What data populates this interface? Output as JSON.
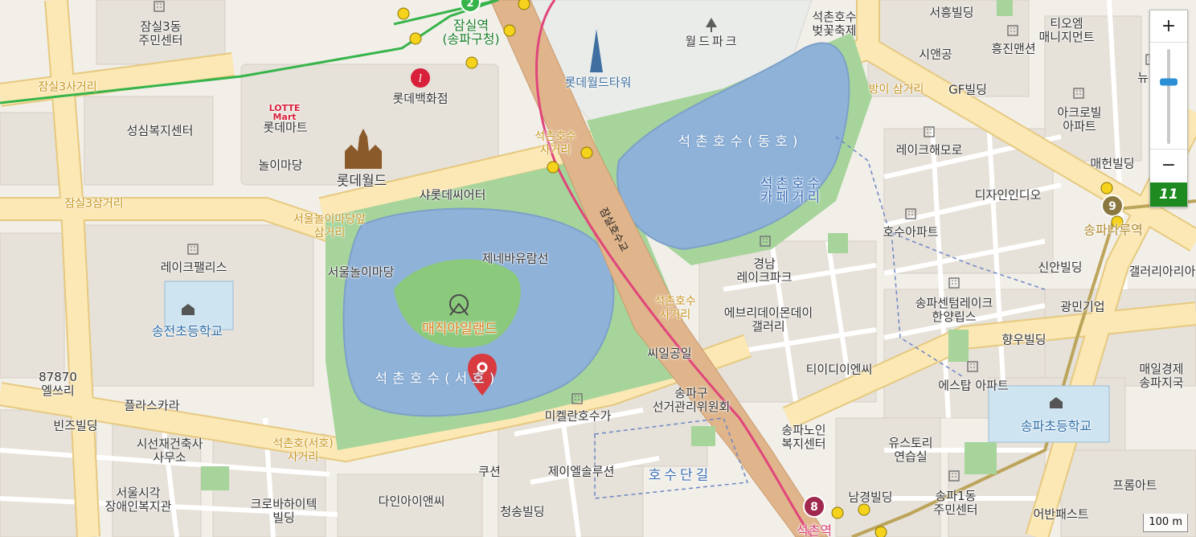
{
  "map": {
    "zoom_level": "11",
    "scale_label": "100 m",
    "zoom_in_label": "+",
    "zoom_out_label": "−",
    "zoom_fraction": 0.35
  },
  "lakes": {
    "west": "석촌호수(서호)",
    "east": "석촌호수(동호)"
  },
  "places": {
    "jamsil3dong": "잠실3동\n주민센터",
    "lotte_dept": "롯데백화점",
    "lotte_mart": "롯데마트",
    "lotte_mart_logo": "LOTTE\nMart",
    "lotte_world": "롯데월드",
    "lotte_world_tower": "롯데월드타워",
    "world_park": "월드파크",
    "seongsim": "성심복지센터",
    "nolimadang": "놀이마당",
    "charlotte": "샤롯데씨어터",
    "seoul_nolimadang": "서울놀이마당",
    "geneva": "제네바유람선",
    "magic_island": "매직아일랜드",
    "lake_palace": "레이크팰리스",
    "songjeon_school": "송전초등학교",
    "elssuri": "87870\n엘쓰리",
    "plaskara": "플라스카라",
    "binz": "빈즈빌딩",
    "sisun": "시선재건축사\n사무소",
    "seoul_sigak": "서울시각\n장애인복지관",
    "croba": "크로바하이텍\n빌딩",
    "dinai": "다인아이앤씨",
    "cheongsong": "청송빌딩",
    "cushion": "쿠션",
    "jayel": "제이엘솔루션",
    "michelan": "미켈란호수가",
    "ssiil": "씨일공일",
    "songpa_election": "송파구\n선거관리위원회",
    "songpa_elder": "송파노인\n복지센터",
    "hosu_danji": "호수단길",
    "lake_cafe": "석촌호수\n카페거리",
    "seokchon_fest": "석촌호수\n벚꽃축제",
    "gyeongnam": "경남\n레이크파크",
    "every": "에브리데이몬데이\n갤러리",
    "tidi": "티이디이엔씨",
    "youstory": "유스토리\n연습실",
    "namgyeong": "남경빌딩",
    "songpa1": "송파1동\n주민센터",
    "prometh": "프롬아트",
    "opass": "어반패스트",
    "songpa_center": "송파센텀레이크\n한양립스",
    "hyangwoo": "향우빌딩",
    "estop": "에스탑 아파트",
    "gwangmin": "광민기업",
    "maeil": "매일경제\n송파지국",
    "songpa_school": "송파초등학교",
    "sinan": "신안빌딩",
    "gallery_ai": "갤러리아리아",
    "design": "디자인인디오",
    "lake_hemore": "레이크해모로",
    "hosu_apt": "호수아파트",
    "maehun": "매헌빌딩",
    "acro": "아크로빌\n아파트",
    "nupa": "뉴파크",
    "gf": "GF빌딩",
    "heungjin": "흥진맨션",
    "siangong": "시앤공",
    "seoheung": "서흥빌딩",
    "tiem": "티오엠\n매니지먼트"
  },
  "intersections": {
    "jamsil3_4": "잠실3사거리",
    "jamsil3_3": "잠실3삼거리",
    "seokchon_n": "석촌호수\n사거리",
    "nolimadang_x": "서울놀이마당앞\n삼거리",
    "seokchon_s": "석촌호수\n사거리",
    "seokchon_w": "석촌호(서호)\n사거리",
    "bangi": "방이 삼거리"
  },
  "roads": {
    "jamsil_hosu": "잠실호수교"
  },
  "stations": {
    "jamsil": "잠실역\n(송파구청)",
    "jamsil_line": "2",
    "seokchon": "석촌역",
    "seokchon_line": "8",
    "songpanaru": "송파나루역",
    "songpanaru_line": "9"
  },
  "colors": {
    "land": "#f2efe9",
    "road_major": "#fbe8b4",
    "road_major_edge": "#e6c980",
    "lake": "#8fb2d9",
    "park": "#a6d49a",
    "park_inner": "#8bc97c",
    "block": "#e6e1d9",
    "block_edge": "#d5cfc5",
    "line2": "#36b44a",
    "line8": "#e0457b",
    "line9": "#bca45a",
    "expressway": "#e0b58c",
    "pin": "#d83a3f"
  }
}
